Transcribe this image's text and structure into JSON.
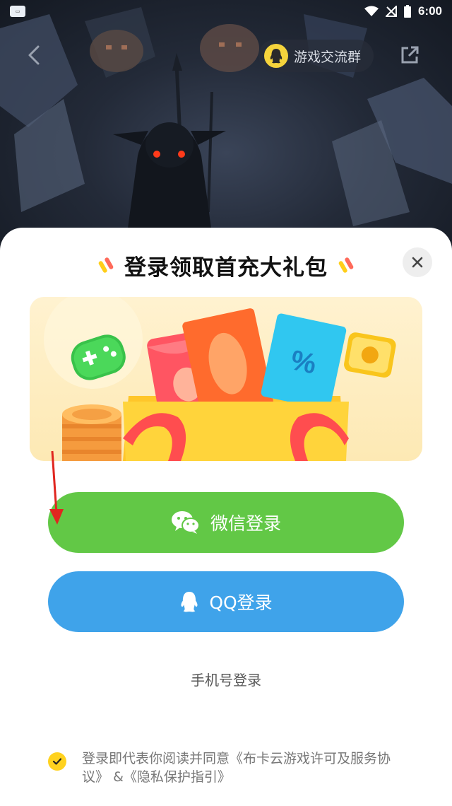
{
  "status_bar": {
    "time": "6:00"
  },
  "top_nav": {
    "group_label": "游戏交流群"
  },
  "sheet": {
    "title": "登录领取首充大礼包",
    "wechat_label": "微信登录",
    "qq_label": "QQ登录",
    "phone_label": "手机号登录",
    "agreement_prefix": "登录即代表你阅读并同意",
    "agreement_service": "《布卡云游戏许可及服务协议》",
    "agreement_amp": "&",
    "agreement_privacy": "《隐私保护指引》",
    "agreement_checked": true
  },
  "colors": {
    "wechat_green": "#62c846",
    "qq_blue": "#3fa3ea",
    "check_yellow": "#ffd21f",
    "annotation_red": "#e0261f"
  },
  "icons": [
    "back-arrow-icon",
    "qq-penguin-icon",
    "share-icon",
    "close-icon",
    "wechat-icon",
    "checkmark-icon",
    "gamepad-icon",
    "coin-icon",
    "red-arrow-icon"
  ]
}
